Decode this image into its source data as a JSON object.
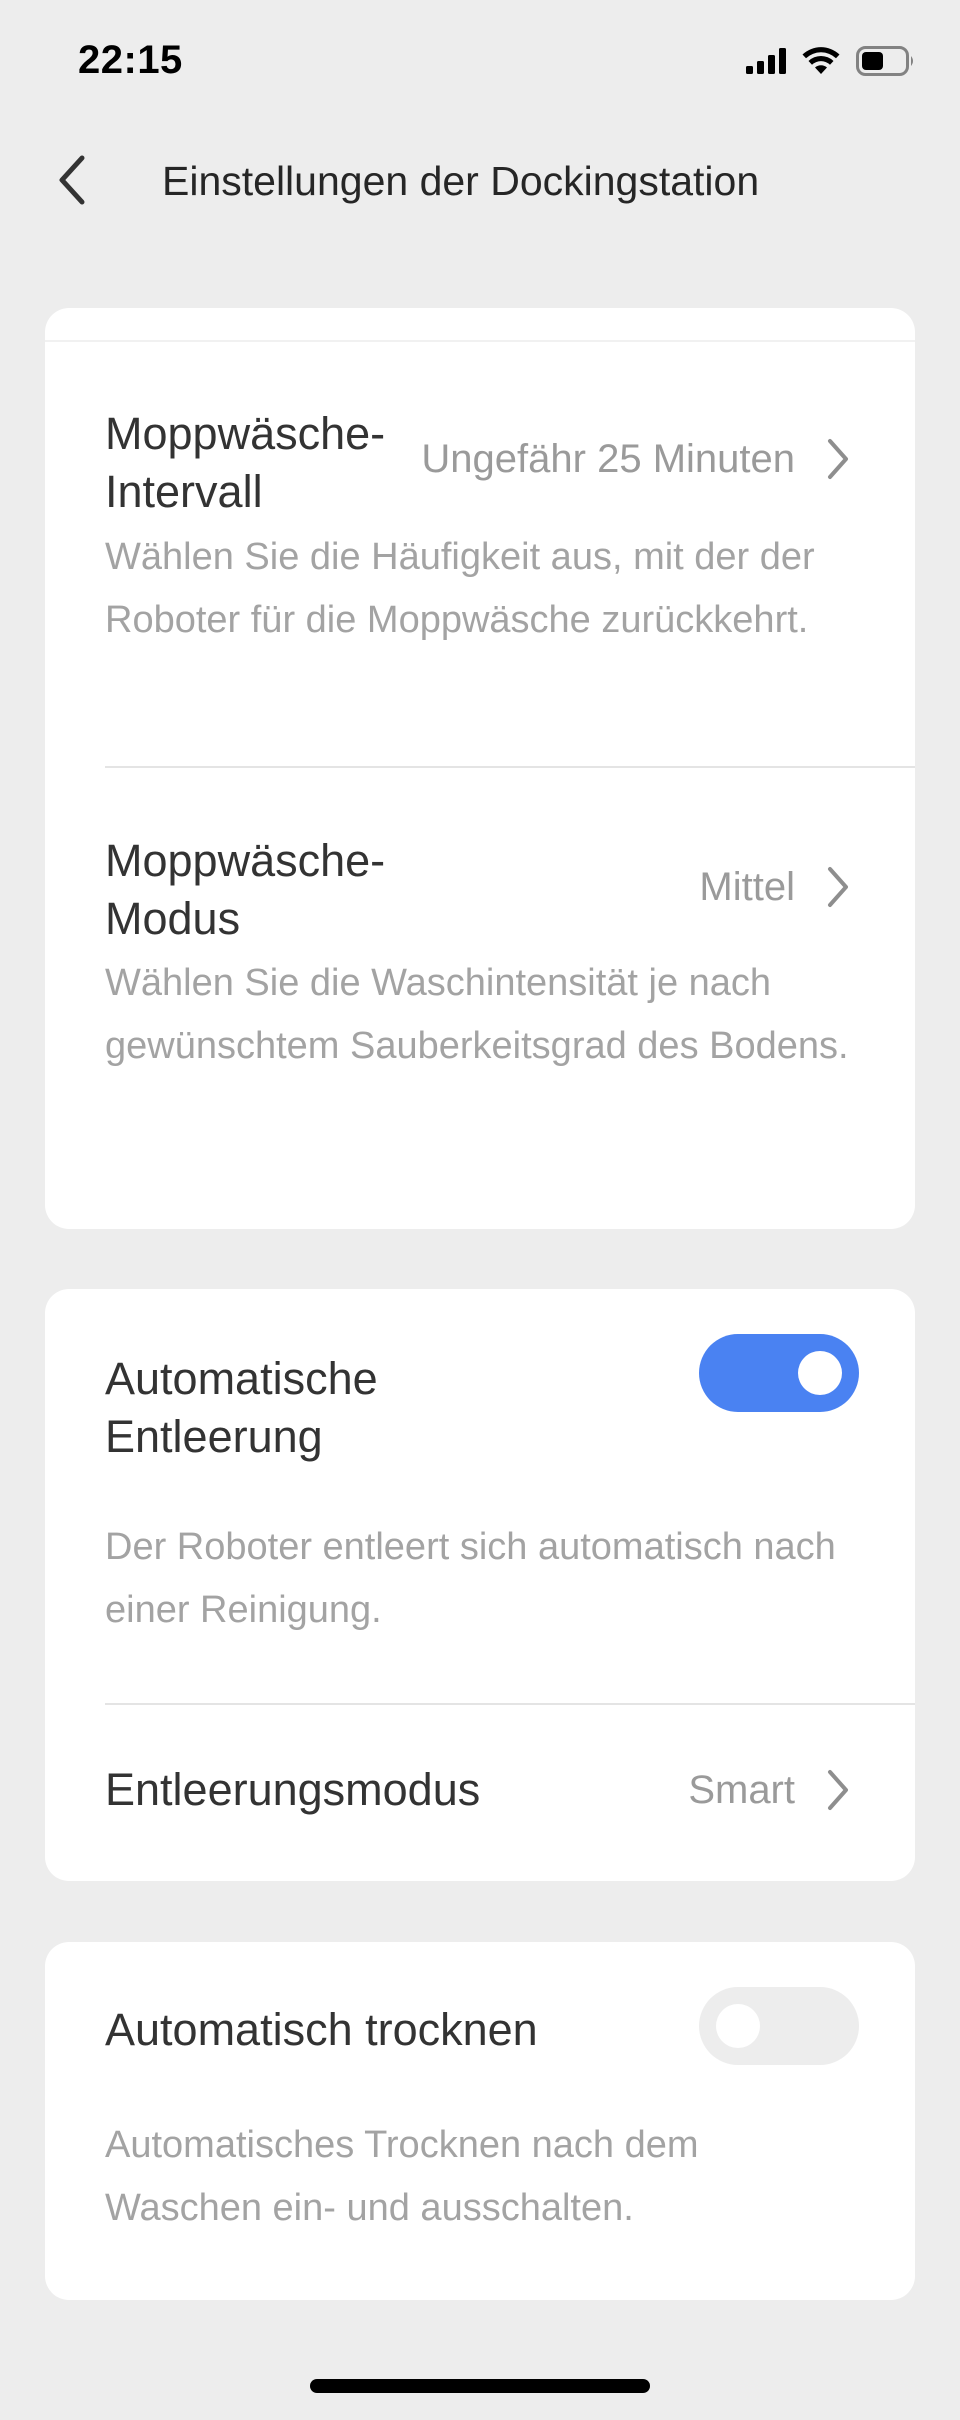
{
  "status_bar": {
    "time": "22:15",
    "icons": [
      "signal-icon",
      "wifi-icon",
      "battery-icon"
    ]
  },
  "header": {
    "back_icon": "chevron-left-icon",
    "title": "Einstellungen der Dockingstation"
  },
  "card1": {
    "mop_interval": {
      "title_line1": "Moppwäsche-",
      "title_line2": "Intervall",
      "value": "Ungefähr 25 Minuten",
      "description": "Wählen Sie die Häufigkeit aus, mit der der Roboter für die Moppwäsche zurückkehrt."
    },
    "mop_mode": {
      "title_line1": "Moppwäsche-",
      "title_line2": "Modus",
      "value": "Mittel",
      "description": "Wählen Sie die Waschintensität je nach gewünschtem Sauberkeitsgrad des Bodens."
    }
  },
  "card2": {
    "auto_empty": {
      "title_line1": "Automatische",
      "title_line2": "Entleerung",
      "enabled": true,
      "description": "Der Roboter entleert sich automatisch nach einer Reinigung."
    },
    "empty_mode": {
      "title": "Entleerungsmodus",
      "value": "Smart"
    }
  },
  "card3": {
    "auto_dry": {
      "title": "Automatisch trocknen",
      "enabled": false,
      "description": "Automatisches Trocknen nach dem Waschen ein- und ausschalten."
    }
  },
  "colors": {
    "background": "#ededed",
    "card": "#ffffff",
    "accent": "#4a82f2",
    "title_text": "#333333",
    "secondary_text": "#9a9a9a"
  }
}
